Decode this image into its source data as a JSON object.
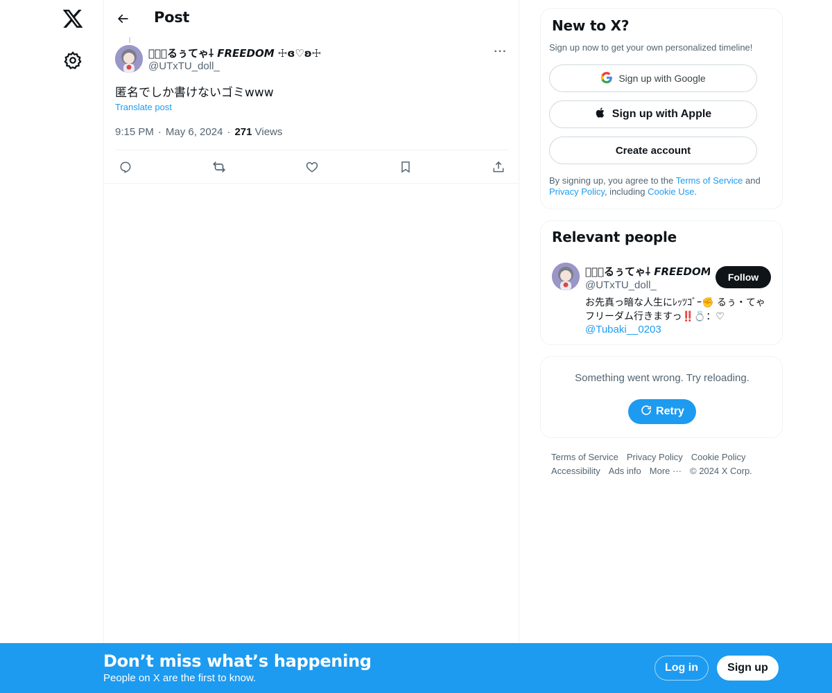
{
  "header": {
    "title": "Post"
  },
  "post": {
    "author_name": "⃝𖤐⃝るぅてゃ⸸ 𝙁𝙍𝙀𝙀𝘿𝙊𝙈 ☩ɞ♡ʚ☩",
    "author_handle": "@UTxTU_doll_",
    "text": "匿名でしか書けないゴミwww",
    "translate_label": "Translate post",
    "time": "9:15 PM",
    "date": "May 6, 2024",
    "views_count": "271",
    "views_label": "Views",
    "more_glyph": "···"
  },
  "signup_card": {
    "title": "New to X?",
    "subtitle": "Sign up now to get your own personalized timeline!",
    "google_label": "Sign up with Google",
    "apple_label": "Sign up with Apple",
    "create_label": "Create account",
    "legal_prefix": "By signing up, you agree to the ",
    "terms_link": "Terms of Service",
    "legal_and": " and ",
    "privacy_link": "Privacy Policy",
    "legal_including": ", including ",
    "cookie_link": "Cookie Use",
    "legal_end": "."
  },
  "people_card": {
    "title": "Relevant people",
    "name": "⃝𖤐⃝るぅてゃ⸸ 𝙁𝙍𝙀𝙀𝘿𝙊𝙈 ☩",
    "handle": "@UTxTU_doll_",
    "follow_label": "Follow",
    "bio": "お先真っ暗な人生にﾚｯﾂｺﾞｰ✊ るぅ・てゃフリーダム行きますっ‼️💍：♡",
    "mention": "@Tubaki__0203"
  },
  "error_card": {
    "message": "Something went wrong. Try reloading.",
    "retry_label": "Retry"
  },
  "footer": {
    "links": [
      "Terms of Service",
      "Privacy Policy",
      "Cookie Policy",
      "Accessibility",
      "Ads info",
      "More ···",
      "© 2024 X Corp."
    ]
  },
  "banner": {
    "title": "Don’t miss what’s happening",
    "subtitle": "People on X are the first to know.",
    "login_label": "Log in",
    "signup_label": "Sign up"
  },
  "colors": {
    "accent": "#1d9bf0",
    "text": "#0f1419",
    "muted": "#536471",
    "border": "#eff3f4"
  }
}
